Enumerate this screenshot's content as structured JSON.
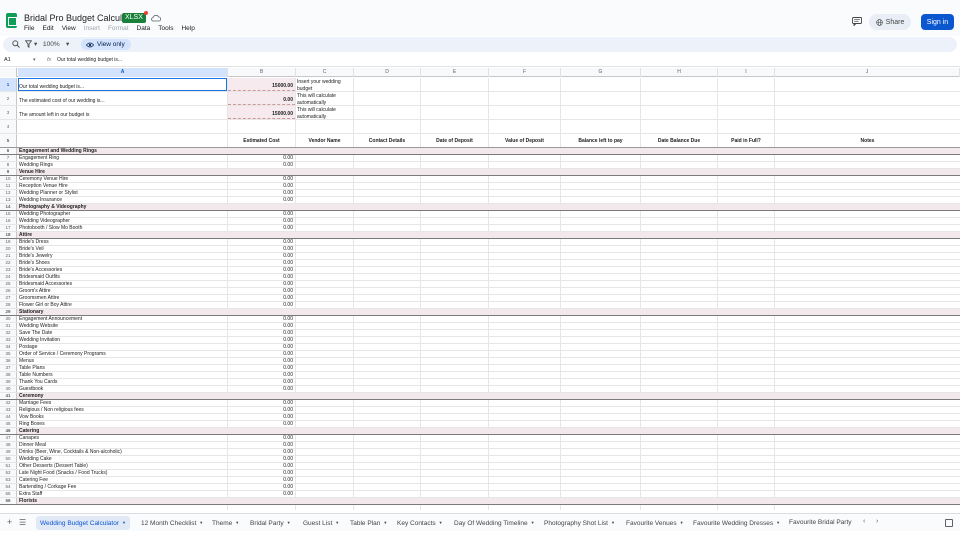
{
  "header": {
    "doc_title": "Bridal Pro Budget Calculator",
    "file_badge": "XLSX",
    "menu": [
      "File",
      "Edit",
      "View",
      "Insert",
      "Format",
      "Data",
      "Tools",
      "Help"
    ],
    "share_label": "Share",
    "signin_label": "Sign in"
  },
  "toolbar": {
    "zoom": "100%",
    "view_only_label": "View only"
  },
  "formula_bar": {
    "cell_ref": "A1",
    "fx": "fx",
    "content": "Our total wedding budget is..."
  },
  "columns": [
    "A",
    "B",
    "C",
    "D",
    "E",
    "F",
    "G",
    "H",
    "I",
    "J"
  ],
  "budget_summary": [
    {
      "row": "1",
      "label": "Our total wedding budget is...",
      "value": "15000.00",
      "note": "Insert your wedding budget"
    },
    {
      "row": "2",
      "label": "The estimated cost of our wedding is...",
      "value": "0.00",
      "note": "This will calculate automatically"
    },
    {
      "row": "3",
      "label": "The amount left in our budget is",
      "value": "15000.00",
      "note": "This will calculate automatically"
    }
  ],
  "table_headers": {
    "row": "5",
    "estimated_cost": "Estimated Cost",
    "vendor_name": "Vendor Name",
    "contact_details": "Contact Details",
    "date_of_deposit": "Date of Deposit",
    "value_of_deposit": "Value of Deposit",
    "balance_left": "Balance left to pay",
    "date_balance_due": "Date Balance Due",
    "paid_in_full": "Paid in Full?",
    "notes": "Notes"
  },
  "rows": [
    {
      "n": "6",
      "label": "Engagement and Wedding Rings",
      "section": true
    },
    {
      "n": "7",
      "label": "Engagement Ring",
      "value": "0.00"
    },
    {
      "n": "8",
      "label": "Wedding Rings",
      "value": "0.00"
    },
    {
      "n": "9",
      "label": "Venue Hire",
      "section": true
    },
    {
      "n": "10",
      "label": "Ceremony Venue Hire",
      "value": "0.00"
    },
    {
      "n": "11",
      "label": "Reception Venue Hire",
      "value": "0.00"
    },
    {
      "n": "12",
      "label": "Wedding Planner or Stylist",
      "value": "0.00"
    },
    {
      "n": "13",
      "label": "Wedding Insurance",
      "value": "0.00"
    },
    {
      "n": "14",
      "label": "Photography & Videography",
      "section": true
    },
    {
      "n": "15",
      "label": "Wedding Photographer",
      "value": "0.00"
    },
    {
      "n": "16",
      "label": "Wedding Videographer",
      "value": "0.00"
    },
    {
      "n": "17",
      "label": "Photobooth / Slow Mo Booth",
      "value": "0.00"
    },
    {
      "n": "18",
      "label": "Attire",
      "section": true
    },
    {
      "n": "19",
      "label": "Bride's Dress",
      "value": "0.00"
    },
    {
      "n": "20",
      "label": "Bride's Veil",
      "value": "0.00"
    },
    {
      "n": "21",
      "label": "Bride's Jewelry",
      "value": "0.00"
    },
    {
      "n": "22",
      "label": "Bride's Shoes",
      "value": "0.00"
    },
    {
      "n": "23",
      "label": "Bride's Accessories",
      "value": "0.00"
    },
    {
      "n": "24",
      "label": "Bridesmaid Outfits",
      "value": "0.00"
    },
    {
      "n": "25",
      "label": "Bridesmaid Accessories",
      "value": "0.00"
    },
    {
      "n": "26",
      "label": "Groom's Attire",
      "value": "0.00"
    },
    {
      "n": "27",
      "label": "Groomsmen Attire",
      "value": "0.00"
    },
    {
      "n": "28",
      "label": "Flower Girl or Boy Attire",
      "value": "0.00"
    },
    {
      "n": "29",
      "label": "Stationary",
      "section": true
    },
    {
      "n": "30",
      "label": "Engagement Announcement",
      "value": "0.00"
    },
    {
      "n": "31",
      "label": "Wedding Website",
      "value": "0.00"
    },
    {
      "n": "32",
      "label": "Save The Date",
      "value": "0.00"
    },
    {
      "n": "33",
      "label": "Wedding Invitation",
      "value": "0.00"
    },
    {
      "n": "34",
      "label": "Postage",
      "value": "0.00"
    },
    {
      "n": "35",
      "label": "Order of Service / Ceremony Programs",
      "value": "0.00"
    },
    {
      "n": "36",
      "label": "Menus",
      "value": "0.00"
    },
    {
      "n": "37",
      "label": "Table Plans",
      "value": "0.00"
    },
    {
      "n": "38",
      "label": "Table Numbers",
      "value": "0.00"
    },
    {
      "n": "39",
      "label": "Thank You Cards",
      "value": "0.00"
    },
    {
      "n": "40",
      "label": "Guestbook",
      "value": "0.00"
    },
    {
      "n": "41",
      "label": "Ceremony",
      "section": true
    },
    {
      "n": "42",
      "label": "Marriage Fees",
      "value": "0.00"
    },
    {
      "n": "43",
      "label": "Religious / Non religious fees",
      "value": "0.00"
    },
    {
      "n": "44",
      "label": "Vow Books",
      "value": "0.00"
    },
    {
      "n": "45",
      "label": "Ring Boxes",
      "value": "0.00"
    },
    {
      "n": "46",
      "label": "Catering",
      "section": true
    },
    {
      "n": "47",
      "label": "Canapes",
      "value": "0.00"
    },
    {
      "n": "48",
      "label": "Dinner Meal",
      "value": "0.00"
    },
    {
      "n": "49",
      "label": "Drinks (Beer, Wine, Cocktails & Non-alcoholic)",
      "value": "0.00"
    },
    {
      "n": "50",
      "label": "Wedding Cake",
      "value": "0.00"
    },
    {
      "n": "51",
      "label": "Other Desserts (Dessert Table)",
      "value": "0.00"
    },
    {
      "n": "52",
      "label": "Late Night Food (Snacks / Food Trucks)",
      "value": "0.00"
    },
    {
      "n": "53",
      "label": "Catering Fee",
      "value": "0.00"
    },
    {
      "n": "54",
      "label": "Bartending / Corkage Fee",
      "value": "0.00"
    },
    {
      "n": "55",
      "label": "Extra Staff",
      "value": "0.00"
    },
    {
      "n": "56",
      "label": "Florists",
      "section": true
    }
  ],
  "sheet_tabs": [
    "Wedding Budget Calculator",
    "12 Month Checklist",
    "Theme",
    "Bridal Party",
    "Guest List",
    "Table Plan",
    "Key Contacts",
    "Day Of Wedding Timeline",
    "Photography Shot List",
    "Favourite Venues",
    "Favourite Wedding Dresses",
    "Favourite Bridal Party"
  ],
  "colors": {
    "accent": "#0b57d0",
    "section_band": "#f3e9ec",
    "sheets_green": "#0f9d58"
  }
}
